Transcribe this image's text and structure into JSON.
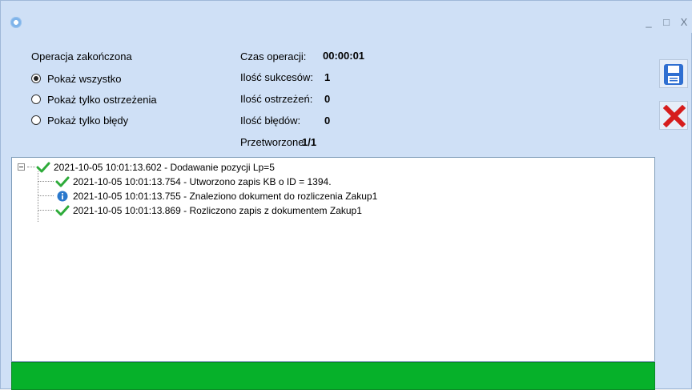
{
  "window": {
    "controls": {
      "minimize": "_",
      "maximize": "□",
      "close": "X"
    }
  },
  "filter": {
    "group_label": "Operacja zakończona",
    "options": [
      {
        "label": "Pokaż wszystko",
        "checked": true
      },
      {
        "label": "Pokaż tylko ostrzeżenia",
        "checked": false
      },
      {
        "label": "Pokaż tylko błędy",
        "checked": false
      }
    ]
  },
  "stats": {
    "time_label": "Czas operacji:",
    "time_value": "00:00:01",
    "success_label": "Ilość sukcesów:",
    "success_value": "1",
    "warnings_label": "Ilość ostrzeżeń:",
    "warnings_value": "0",
    "errors_label": "Ilość błędów:",
    "errors_value": "0",
    "processed_label": "Przetworzone:",
    "processed_value": "1/1"
  },
  "side_buttons": {
    "save_icon": "save-icon",
    "delete_icon": "delete-icon"
  },
  "log": {
    "root": {
      "text": "2021-10-05 10:01:13.602 - Dodawanie pozycji Lp=5",
      "icon": "checkmark-icon"
    },
    "children": [
      {
        "text": "2021-10-05 10:01:13.754 - Utworzono zapis KB o ID = 1394.",
        "icon": "checkmark-icon"
      },
      {
        "text": "2021-10-05 10:01:13.755 - Znaleziono dokument do rozliczenia Zakup1",
        "icon": "info-icon"
      },
      {
        "text": "2021-10-05 10:01:13.869 - Rozliczono zapis z dokumentem Zakup1",
        "icon": "checkmark-icon"
      }
    ]
  },
  "progress": {
    "value": 1.0,
    "color": "#06b12a"
  },
  "colors": {
    "window_bg": "#cfe0f6",
    "success_green": "#2eab3a",
    "error_red": "#d61c1c",
    "save_blue": "#2f6fd1",
    "info_blue": "#2a78cc"
  }
}
